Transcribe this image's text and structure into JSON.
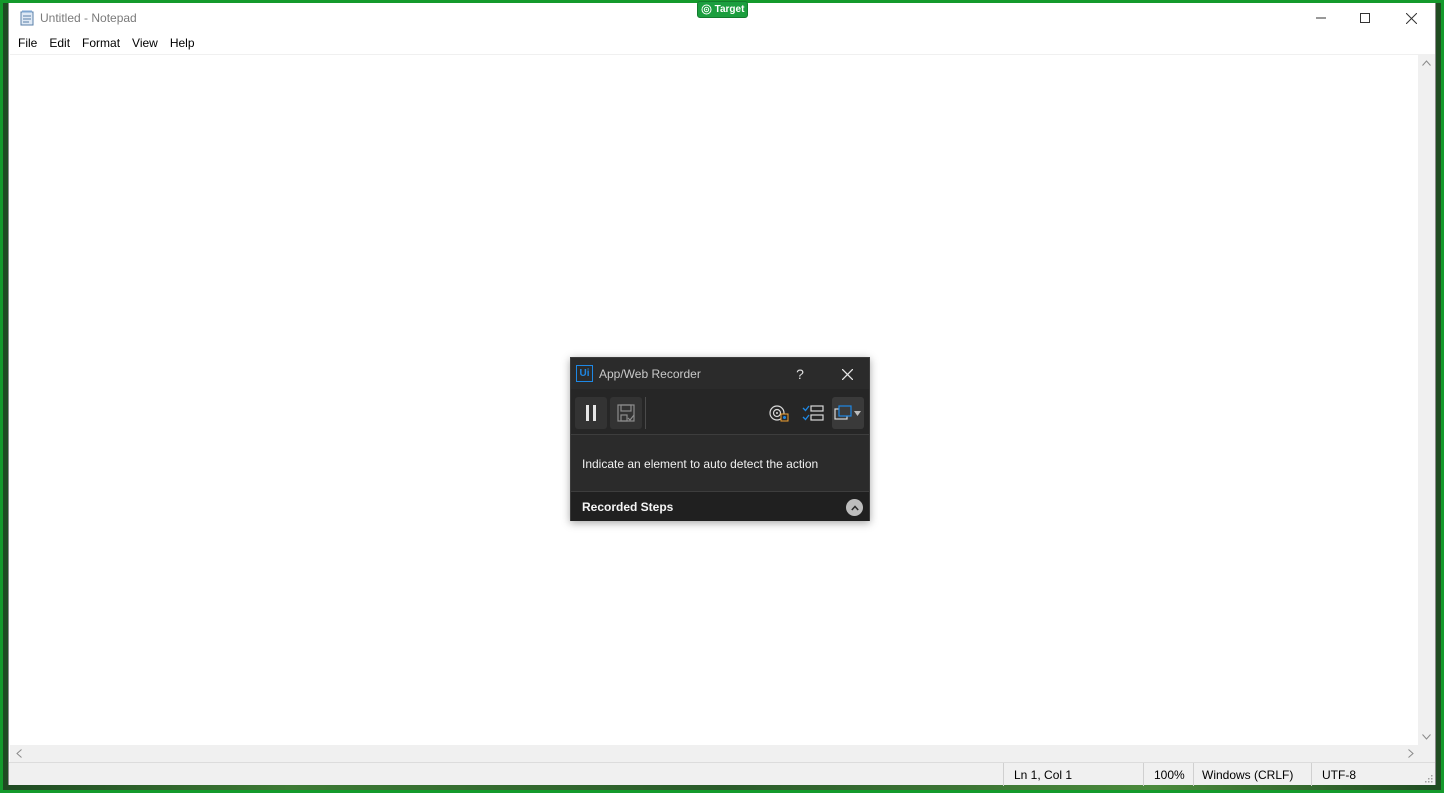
{
  "notepad": {
    "title": "Untitled - Notepad",
    "menu": [
      "File",
      "Edit",
      "Format",
      "View",
      "Help"
    ],
    "status": {
      "position": "Ln 1, Col 1",
      "zoom": "100%",
      "line_endings": "Windows (CRLF)",
      "encoding": "UTF-8"
    }
  },
  "target_badge": {
    "label": "Target"
  },
  "recorder": {
    "logo_text": "Ui",
    "title": "App/Web Recorder",
    "help_label": "?",
    "message": "Indicate an element to auto detect the action",
    "recorded_steps_label": "Recorded Steps"
  },
  "colors": {
    "frame_green": "#149a2c",
    "recorder_bg": "#2b2b2b",
    "uipath_blue": "#1e88e5"
  }
}
